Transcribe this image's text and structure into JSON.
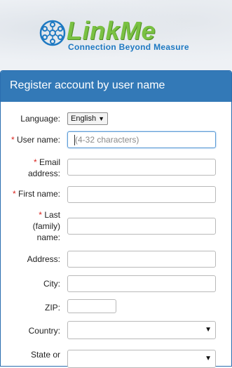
{
  "brand": {
    "name": "LinkMe",
    "tagline": "Connection Beyond Measure",
    "colors": {
      "green": "#7ac143",
      "blue": "#1e79c2",
      "header": "#3379b7"
    }
  },
  "panel": {
    "title": "Register account by user name"
  },
  "form": {
    "language": {
      "label": "Language:",
      "value": "English"
    },
    "username": {
      "required": "*",
      "label": "User name:",
      "placeholder": "(4-32 characters)"
    },
    "email": {
      "required": "*",
      "label_line1": "Email",
      "label_line2": "address:"
    },
    "first_name": {
      "required": "*",
      "label": "First name:"
    },
    "last_name": {
      "required": "*",
      "label_line1": "Last",
      "label_line2": "(family)",
      "label_line3": "name:"
    },
    "address": {
      "label": "Address:"
    },
    "city": {
      "label": "City:"
    },
    "zip": {
      "label": "ZIP:"
    },
    "country": {
      "label": "Country:"
    },
    "state": {
      "label": "State or"
    }
  },
  "icons": {
    "select_arrow": "chevron-down-icon"
  }
}
